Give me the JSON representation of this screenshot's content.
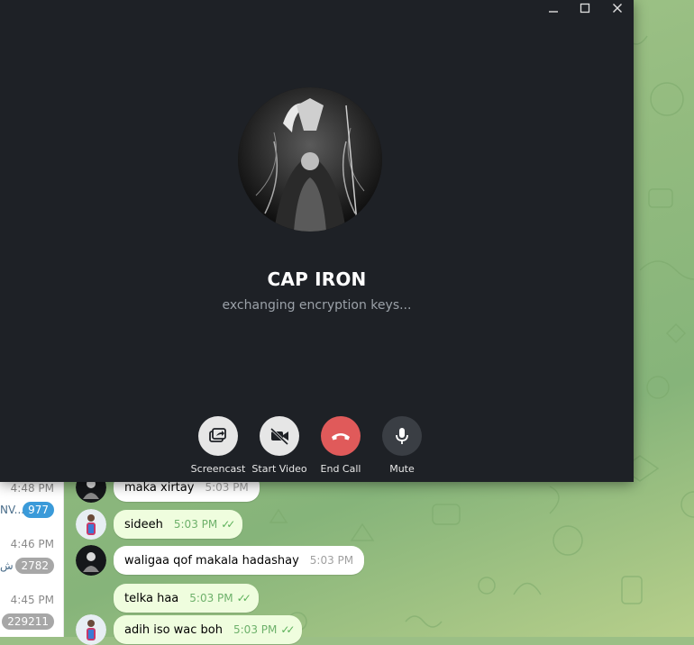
{
  "call": {
    "name": "CAP IRON",
    "status": "exchanging encryption keys...",
    "controls": {
      "screencast": "Screencast",
      "start_video": "Start Video",
      "end_call": "End Call",
      "mute": "Mute"
    },
    "window_controls": [
      "minimize",
      "maximize",
      "close"
    ]
  },
  "chat_list": [
    {
      "time": "4:48 PM",
      "snippet": "NV...",
      "badge": "977",
      "badge_color": "#3a9ad9"
    },
    {
      "time": "4:46 PM",
      "snippet": "ش",
      "badge": "2782",
      "badge_color": "#a7a7a7"
    },
    {
      "time": "4:45 PM",
      "snippet": "",
      "badge": "229211",
      "badge_color": "#a7a7a7"
    }
  ],
  "messages": [
    {
      "text": "maka xirtay",
      "time": "5:03 PM",
      "read": false
    },
    {
      "text": "sideeh",
      "time": "5:03 PM",
      "read": true
    },
    {
      "text": "waligaa qof makala hadashay",
      "time": "5:03 PM",
      "read": false
    },
    {
      "text": "telka haa",
      "time": "5:03 PM",
      "read": true
    },
    {
      "text": "adih iso wac boh",
      "time": "5:03 PM",
      "read": true
    }
  ],
  "colors": {
    "call_bg": "#1e2126",
    "end_call_red": "#e05a5a",
    "control_grey": "#e6e6e6",
    "mute_dark": "#3a3e44",
    "outgoing_bubble": "#effdde",
    "incoming_bubble": "#ffffff",
    "read_tick_green": "#5cb15a"
  }
}
